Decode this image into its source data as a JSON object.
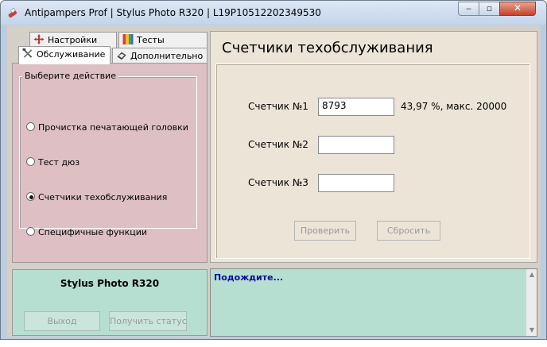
{
  "window": {
    "title": "Antipampers Prof  |  Stylus Photo R320  |  L19P10512202349530",
    "controls": {
      "minimize_glyph": "‒",
      "maximize_glyph": "▫",
      "close_glyph": "✕"
    }
  },
  "tabs": [
    {
      "label": "Настройки",
      "icon": "settings-cross-icon"
    },
    {
      "label": "Тесты",
      "icon": "color-test-icon"
    },
    {
      "label": "Обслуживание",
      "icon": "tools-icon",
      "selected": true
    },
    {
      "label": "Дополнительно",
      "icon": "eraser-icon"
    }
  ],
  "actions": {
    "group_label": "Выберите действие",
    "options": [
      {
        "label": "Прочистка печатающей головки",
        "checked": false
      },
      {
        "label": "Тест дюз",
        "checked": false
      },
      {
        "label": "Счетчики техобслуживания",
        "checked": true
      },
      {
        "label": "Специфичные функции",
        "checked": false
      }
    ]
  },
  "main": {
    "title": "Счетчики техобслуживания",
    "counters": [
      {
        "label": "Счетчик  №1",
        "value": "8793",
        "note": "43,97 %, макс. 20000"
      },
      {
        "label": "Счетчик  №2",
        "value": "",
        "note": ""
      },
      {
        "label": "Счетчик  №3",
        "value": "",
        "note": ""
      }
    ],
    "check_button": "Проверить",
    "reset_button": "Сбросить"
  },
  "status": {
    "model": "Stylus Photo R320",
    "exit_button": "Выход",
    "get_status_button": "Получить статус"
  },
  "log": {
    "text": "Подождите..."
  },
  "colors": {
    "left_panel": "#dec0c4",
    "right_panel": "#ece4d7",
    "status_panel": "#b6dfd1",
    "log_text": "#0a0aa0"
  }
}
